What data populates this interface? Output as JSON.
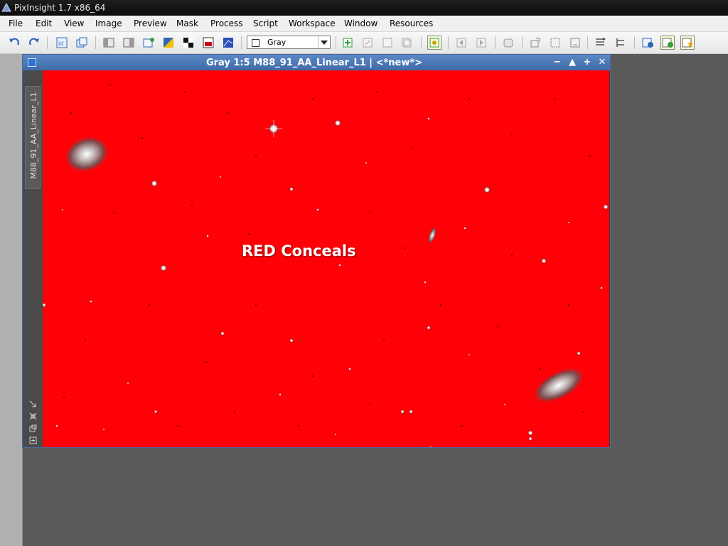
{
  "app": {
    "title": "PixInsight 1.7 x86_64"
  },
  "menu": {
    "items": [
      "File",
      "Edit",
      "View",
      "Image",
      "Preview",
      "Mask",
      "Process",
      "Script",
      "Workspace",
      "Window",
      "Resources"
    ]
  },
  "toolbar": {
    "mask_mode_value": "Gray",
    "icons": [
      "undo-icon",
      "redo-icon",
      "identifier-icon",
      "clone-icon",
      "zoom-fit-icon",
      "zoom-window-icon",
      "new-preview-icon",
      "invert-icon",
      "mask-show-icon",
      "screen-transfer-icon",
      "auto-stretch-icon",
      "rgb-icon"
    ]
  },
  "image_window": {
    "title": "Gray 1:5 M88_91_AA_Linear_L1 | <*new*>",
    "view_tab_label": "M88_91_AA_Linear_L1",
    "canvas_overlay_text": "RED Conceals",
    "mask_color": "#ff0007"
  },
  "colors": {
    "workspace": "#5a5a5a",
    "window_title": "#4d7bbd"
  }
}
